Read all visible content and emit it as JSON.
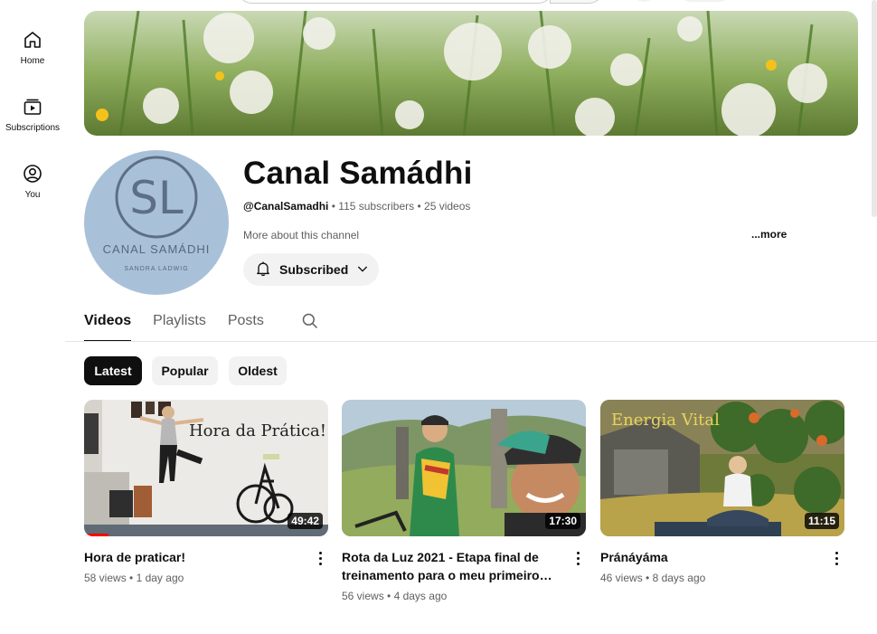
{
  "nav": {
    "items": [
      {
        "label": "Home",
        "icon": "home-icon"
      },
      {
        "label": "Subscriptions",
        "icon": "subscriptions-icon"
      },
      {
        "label": "You",
        "icon": "you-icon"
      }
    ]
  },
  "channel": {
    "title": "Canal Samádhi",
    "handle": "@CanalSamadhi",
    "subscribers": "115 subscribers",
    "videos": "25 videos",
    "separator": "•",
    "description": "More about this channel",
    "more_label": "...more",
    "subscribe_label": "Subscribed",
    "avatar": {
      "logo_text": "SL",
      "name": "CANAL SAMÁDHI",
      "subtitle": "SANDRA LADWIG"
    }
  },
  "tabs": [
    {
      "label": "Videos",
      "active": true
    },
    {
      "label": "Playlists",
      "active": false
    },
    {
      "label": "Posts",
      "active": false
    }
  ],
  "chips": [
    {
      "label": "Latest",
      "active": true
    },
    {
      "label": "Popular",
      "active": false
    },
    {
      "label": "Oldest",
      "active": false
    }
  ],
  "videos": [
    {
      "title": "Hora de praticar!",
      "views": "58 views",
      "age": "1 day ago",
      "duration": "49:42",
      "thumb_text": "Hora da Prática!",
      "watched_fraction": 0.1
    },
    {
      "title": "Rota da Luz 2021 - Etapa final de treinamento para o meu primeiro…",
      "views": "56 views",
      "age": "4 days ago",
      "duration": "17:30",
      "thumb_text": ""
    },
    {
      "title": "Pránáyáma",
      "views": "46 views",
      "age": "8 days ago",
      "duration": "11:15",
      "thumb_text": "Energia Vital"
    }
  ],
  "colors": {
    "accent": "#0f0f0f",
    "chip_bg": "#f2f2f2",
    "avatar_bg": "#a9c1d8",
    "progress": "#ff0000"
  }
}
